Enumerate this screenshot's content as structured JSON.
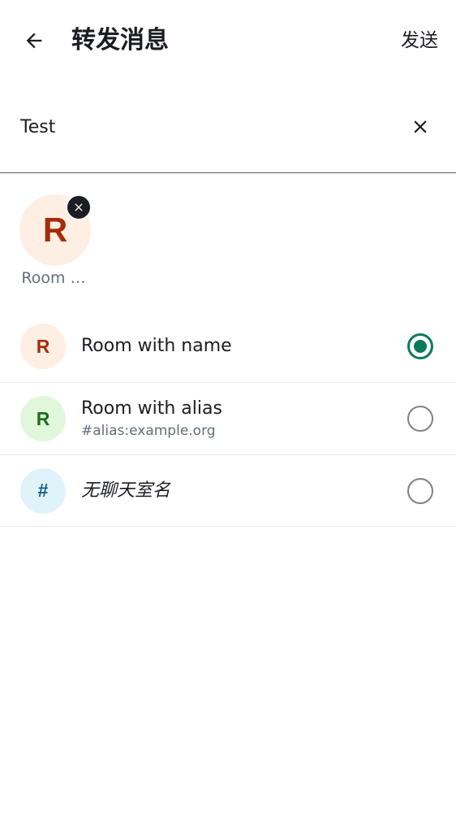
{
  "header": {
    "title": "转发消息",
    "send_label": "发送",
    "back_icon": "arrow-left-icon"
  },
  "search": {
    "value": "Test",
    "clear_icon": "close-icon"
  },
  "selected": [
    {
      "initial": "R",
      "label": "Room …",
      "remove_icon": "close-icon"
    }
  ],
  "rooms": [
    {
      "initial": "R",
      "name": "Room with name",
      "alias": "",
      "selected": true,
      "avatar_bg": "#ffeee3",
      "avatar_fg": "#a32c0b"
    },
    {
      "initial": "R",
      "name": "Room with alias",
      "alias": "#alias:example.org",
      "selected": false,
      "avatar_bg": "#e1f7dc",
      "avatar_fg": "#1a6e1b"
    },
    {
      "initial": "#",
      "name": "无聊天室名",
      "alias": "",
      "selected": false,
      "avatar_bg": "#e1f3fa",
      "avatar_fg": "#0b5d8a"
    }
  ],
  "colors": {
    "accent": "#0b7a5b",
    "divider": "#e6e8ec"
  }
}
